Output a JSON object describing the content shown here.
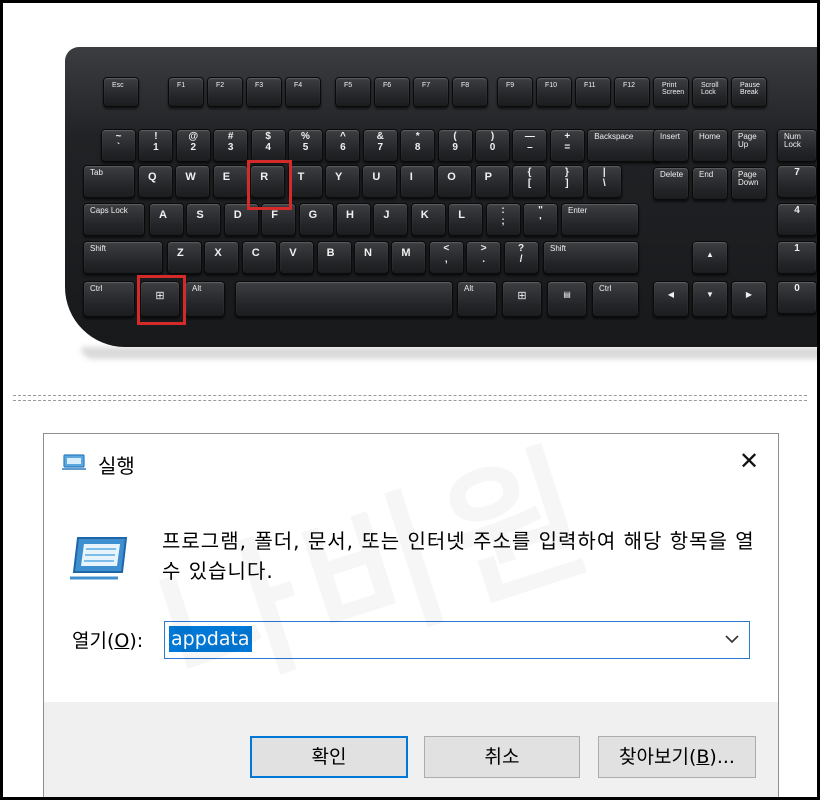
{
  "keyboard": {
    "function_row": [
      "Esc",
      "F1",
      "F2",
      "F3",
      "F4",
      "F5",
      "F6",
      "F7",
      "F8",
      "F9",
      "F10",
      "F11",
      "F12"
    ],
    "system_keys": [
      "Print\nScreen",
      "Scroll\nLock",
      "Pause\nBreak"
    ],
    "number_row": [
      "~\n`",
      "!\n1",
      "@\n2",
      "#\n3",
      "$\n4",
      "%\n5",
      "^\n6",
      "&\n7",
      "*\n8",
      "(\n9",
      ")\n0",
      "—\n–",
      "+\n=",
      "Backspace"
    ],
    "top_row": [
      "Tab",
      "Q",
      "W",
      "E",
      "R",
      "T",
      "Y",
      "U",
      "I",
      "O",
      "P",
      "{\n[",
      "}\n]",
      "|\n\\"
    ],
    "home_row": [
      "Caps\nLock",
      "A",
      "S",
      "D",
      "F",
      "G",
      "H",
      "J",
      "K",
      "L",
      ":\n;",
      "\"\n'",
      "Enter"
    ],
    "bottom_row": [
      "Shift",
      "Z",
      "X",
      "C",
      "V",
      "B",
      "N",
      "M",
      "<\n,",
      ">\n.",
      "?\n/",
      "Shift"
    ],
    "space_row": [
      "Ctrl",
      "⊞",
      "Alt",
      "",
      "Alt",
      "⊞",
      "▤",
      "Ctrl"
    ],
    "nav_keys": [
      "Insert",
      "Home",
      "Page\nUp",
      "Delete",
      "End",
      "Page\nDown"
    ],
    "arrow_keys": [
      "▲",
      "◀",
      "▼",
      "▶"
    ],
    "numpad_keys": [
      "Num\nLock",
      "7",
      "4",
      "1",
      "0"
    ],
    "highlighted_keys": [
      "R",
      "Windows"
    ],
    "highlight_color": "#d52a2a"
  },
  "watermark": "나비원",
  "dialog": {
    "title": "실행",
    "close_glyph": "✕",
    "description": "프로그램, 폴더, 문서, 또는 인터넷 주소를 입력하여 해당 항목을 열 수 있습니다.",
    "open_label_prefix": "열기(",
    "open_label_mnemonic": "O",
    "open_label_suffix": "):",
    "input_value": "appdata",
    "ok_label": "확인",
    "cancel_label": "취소",
    "browse_label_prefix": "찾아보기(",
    "browse_label_mnemonic": "B",
    "browse_label_suffix": ")...",
    "accent_color": "#0078d7"
  }
}
